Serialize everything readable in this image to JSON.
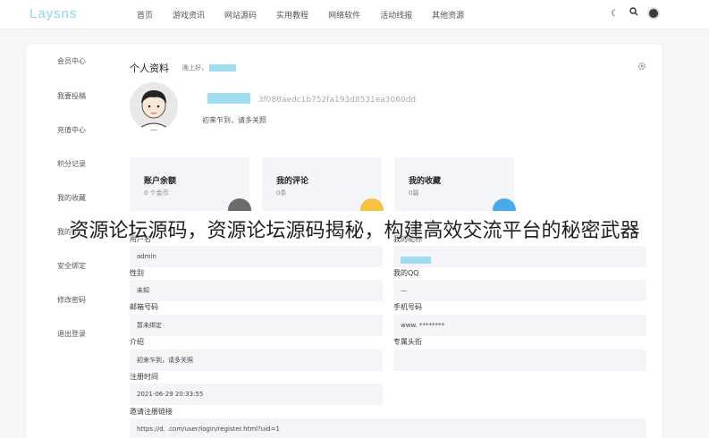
{
  "header": {
    "logo": "Laysns",
    "nav": [
      "首页",
      "游戏资讯",
      "网站源码",
      "实用教程",
      "网络软件",
      "活动线报",
      "其他资源"
    ],
    "tools": {
      "moon": "☾",
      "search": "⚲"
    }
  },
  "sidebar": {
    "items": [
      "会员中心",
      "我要投稿",
      "充值中心",
      "积分记录",
      "我的收藏",
      "我的账户",
      "安全绑定",
      "修改密码",
      "退出登录"
    ]
  },
  "profile": {
    "title": "个人资料",
    "greeting": "晚上好，",
    "uid": "3f088aedc1b752fa193d8531ea3060dd",
    "motto": "初来乍到，请多关照"
  },
  "stats": [
    {
      "title": "账户余额",
      "value": "0 个金币",
      "color": "#6b6b6b"
    },
    {
      "title": "我的评论",
      "value": "0条",
      "color": "#f5c242"
    },
    {
      "title": "我的收藏",
      "value": "0篇",
      "color": "#4aa9e8"
    }
  ],
  "fields": {
    "username_label": "用户名",
    "username": "admin",
    "nickname_label": "我的昵称",
    "gender_label": "性别",
    "gender": "未知",
    "qq_label": "我的QQ",
    "qq": "—",
    "email_label": "邮箱号码",
    "email": "暂未绑定",
    "phone_label": "手机号码",
    "phone": "www.        ********",
    "intro_label": "介绍",
    "intro": "初来乍到，请多关照",
    "avatar_label": "专属头衔",
    "regtime_label": "注册时间",
    "regtime": "2021-06-29 20:33:55",
    "invite_label": "邀请注册链接",
    "invite": "https://d.        .com/user/login/register.html?uid=1"
  },
  "overlay_text": "资源论坛源码，资源论坛源码揭秘，构建高效交流平台的秘密武器"
}
